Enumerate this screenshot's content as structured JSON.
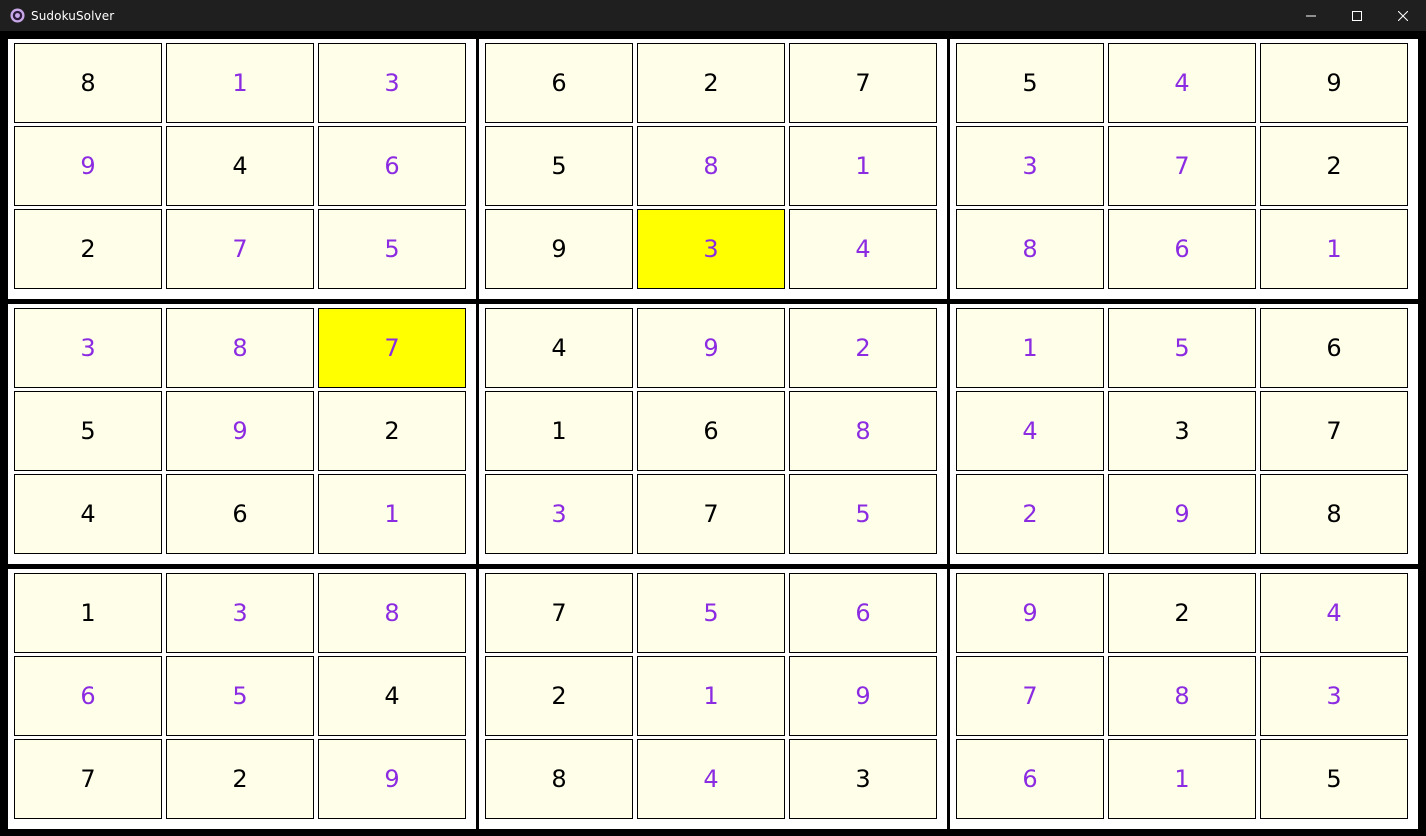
{
  "window": {
    "title": "SudokuSolver",
    "app_icon": "app-logo-icon",
    "controls": [
      "minimize-icon",
      "maximize-icon",
      "close-icon"
    ]
  },
  "colors": {
    "given": "#000000",
    "filled": "#8b2be2",
    "cell_background": "#fffee8",
    "highlight": "#ffff00",
    "border": "#000000"
  },
  "board": {
    "rows": [
      [
        "8",
        "1",
        "3",
        "6",
        "2",
        "7",
        "5",
        "4",
        "9"
      ],
      [
        "9",
        "4",
        "6",
        "5",
        "8",
        "1",
        "3",
        "7",
        "2"
      ],
      [
        "2",
        "7",
        "5",
        "9",
        "3",
        "4",
        "8",
        "6",
        "1"
      ],
      [
        "3",
        "8",
        "7",
        "4",
        "9",
        "2",
        "1",
        "5",
        "6"
      ],
      [
        "5",
        "9",
        "2",
        "1",
        "6",
        "8",
        "4",
        "3",
        "7"
      ],
      [
        "4",
        "6",
        "1",
        "3",
        "7",
        "5",
        "2",
        "9",
        "8"
      ],
      [
        "1",
        "3",
        "8",
        "7",
        "5",
        "6",
        "9",
        "2",
        "4"
      ],
      [
        "6",
        "5",
        "4",
        "2",
        "1",
        "9",
        "7",
        "8",
        "3"
      ],
      [
        "7",
        "2",
        "9",
        "8",
        "4",
        "3",
        "6",
        "1",
        "5"
      ]
    ],
    "given": [
      [
        1,
        0,
        0,
        1,
        1,
        1,
        1,
        0,
        1
      ],
      [
        0,
        1,
        0,
        1,
        0,
        0,
        0,
        0,
        1
      ],
      [
        1,
        0,
        0,
        1,
        0,
        0,
        0,
        0,
        0
      ],
      [
        0,
        0,
        0,
        1,
        0,
        0,
        0,
        0,
        1
      ],
      [
        1,
        0,
        1,
        1,
        1,
        0,
        0,
        1,
        1
      ],
      [
        1,
        1,
        0,
        0,
        1,
        0,
        0,
        0,
        1
      ],
      [
        1,
        0,
        0,
        1,
        0,
        0,
        0,
        1,
        0
      ],
      [
        0,
        0,
        1,
        1,
        0,
        0,
        0,
        0,
        0
      ],
      [
        1,
        1,
        0,
        1,
        0,
        1,
        0,
        0,
        1
      ]
    ],
    "highlighted_cells": [
      [
        2,
        4
      ],
      [
        3,
        2
      ]
    ]
  }
}
